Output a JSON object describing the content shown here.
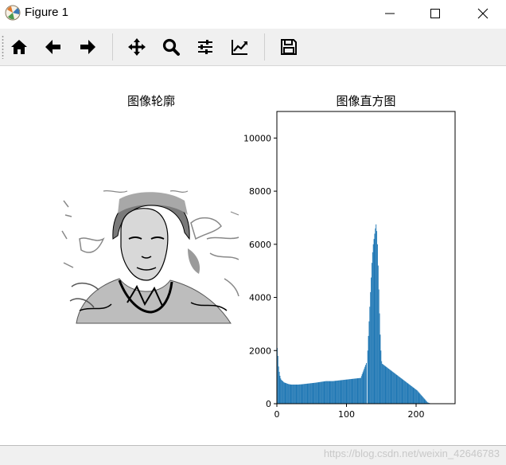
{
  "window": {
    "title": "Figure 1",
    "buttons": [
      "minimize",
      "maximize",
      "close"
    ]
  },
  "toolbar": {
    "tools": [
      {
        "name": "home",
        "icon": "home-icon"
      },
      {
        "name": "back",
        "icon": "arrow-left-icon"
      },
      {
        "name": "forward",
        "icon": "arrow-right-icon"
      },
      {
        "name": "pan",
        "icon": "move-icon"
      },
      {
        "name": "zoom",
        "icon": "magnifier-icon"
      },
      {
        "name": "subplots",
        "icon": "sliders-icon"
      },
      {
        "name": "customize",
        "icon": "line-chart-icon"
      },
      {
        "name": "save",
        "icon": "save-icon"
      }
    ]
  },
  "figure": {
    "left_title": "图像轮廓",
    "right_title": "图像直方图"
  },
  "chart_data": {
    "type": "bar",
    "title": "图像直方图",
    "xlim": [
      0,
      256
    ],
    "ylim": [
      0,
      11000
    ],
    "xticks": [
      0,
      100,
      200
    ],
    "yticks": [
      0,
      2000,
      4000,
      6000,
      8000,
      10000
    ],
    "bar_color": "#1f77b4",
    "bin_count": 256,
    "values": [
      2100,
      1800,
      1400,
      1200,
      1050,
      950,
      900,
      870,
      850,
      820,
      800,
      790,
      780,
      770,
      760,
      750,
      740,
      735,
      730,
      725,
      720,
      720,
      720,
      720,
      720,
      720,
      720,
      720,
      720,
      720,
      720,
      722,
      724,
      726,
      728,
      730,
      733,
      736,
      739,
      742,
      745,
      748,
      751,
      754,
      757,
      760,
      763,
      766,
      769,
      772,
      775,
      778,
      781,
      784,
      787,
      790,
      794,
      798,
      802,
      806,
      810,
      814,
      818,
      822,
      826,
      830,
      834,
      838,
      842,
      846,
      850,
      850,
      850,
      850,
      850,
      850,
      850,
      850,
      850,
      850,
      850,
      853,
      856,
      859,
      862,
      865,
      868,
      871,
      874,
      877,
      880,
      883,
      886,
      889,
      892,
      895,
      898,
      901,
      904,
      907,
      910,
      913,
      916,
      919,
      922,
      925,
      928,
      931,
      934,
      937,
      940,
      943,
      946,
      949,
      952,
      955,
      958,
      961,
      964,
      967,
      970,
      1040,
      1110,
      1180,
      1250,
      1320,
      1390,
      1460,
      1530,
      0,
      2000,
      2550,
      3100,
      3650,
      4200,
      4750,
      5300,
      5700,
      6000,
      6200,
      6400,
      6600,
      6750,
      6500,
      6000,
      5200,
      4300,
      3400,
      2600,
      2000,
      1600,
      1500,
      1480,
      1460,
      1440,
      1420,
      1400,
      1380,
      1360,
      1340,
      1320,
      1300,
      1280,
      1260,
      1240,
      1220,
      1200,
      1180,
      1160,
      1140,
      1120,
      1100,
      1080,
      1060,
      1040,
      1020,
      1000,
      980,
      960,
      940,
      920,
      900,
      880,
      860,
      840,
      820,
      800,
      780,
      760,
      740,
      720,
      700,
      680,
      660,
      640,
      620,
      600,
      580,
      560,
      540,
      520,
      500,
      470,
      440,
      410,
      380,
      350,
      320,
      290,
      260,
      230,
      200,
      170,
      140,
      110,
      80,
      50,
      40,
      30,
      20,
      15,
      10,
      8,
      6,
      4,
      3,
      2,
      1,
      1,
      1,
      0,
      0,
      0,
      0,
      0,
      0,
      0,
      0,
      0,
      0,
      0,
      0,
      0,
      0,
      0,
      0,
      0,
      0,
      0,
      0,
      0,
      0,
      0,
      0,
      0,
      0,
      0,
      0,
      0,
      0,
      0,
      0,
      0,
      0,
      0,
      0,
      0,
      0,
      0
    ]
  },
  "statusbar": {
    "watermark": "https://blog.csdn.net/weixin_42646783"
  }
}
